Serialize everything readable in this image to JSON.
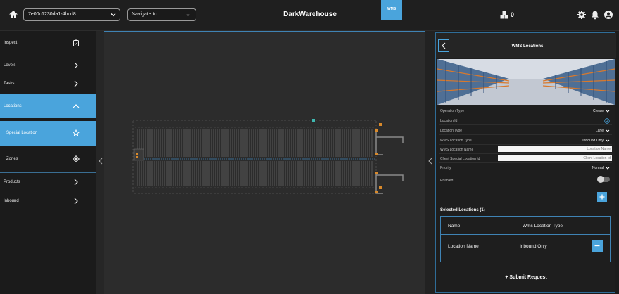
{
  "header": {
    "title": "DarkWarehouse",
    "warehouse_selector": "7e00c1230da1-4bcd8...",
    "navigate_placeholder": "Navigate to",
    "active_tab": "WMS",
    "alerts_count": "0"
  },
  "sidebar": {
    "items": [
      {
        "label": "Inspect"
      },
      {
        "label": "Levels"
      },
      {
        "label": "Tasks"
      },
      {
        "label": "Locations"
      },
      {
        "label": "Special Location"
      },
      {
        "label": "Zones"
      },
      {
        "label": "Products"
      },
      {
        "label": "Inbound"
      }
    ]
  },
  "panel": {
    "title": "WMS Locations",
    "fields": {
      "operation_type": {
        "label": "Operation Type",
        "value": "Create"
      },
      "location_id": {
        "label": "Location Id"
      },
      "location_type": {
        "label": "Location Type",
        "value": "Lane"
      },
      "wms_location_type": {
        "label": "WMS Location Type",
        "value": "Inbound Only"
      },
      "wms_location_name": {
        "label": "WMS Location Name",
        "placeholder": "Location Name"
      },
      "client_special_location_id": {
        "label": "Client Special Location Id",
        "placeholder": "Client Location Id"
      },
      "priority": {
        "label": "Priority",
        "value": "Normal"
      },
      "enabled": {
        "label": "Enabled"
      }
    },
    "selected_locations_title": "Selected Locations (1)",
    "table": {
      "columns": [
        "Name",
        "Wms Location Type"
      ],
      "rows": [
        {
          "name": "Location Name",
          "type": "Inbound Only"
        }
      ]
    },
    "submit_label": "Submit Request"
  },
  "colors": {
    "accent": "#4aa4dc",
    "background": "#1c1c1c"
  }
}
